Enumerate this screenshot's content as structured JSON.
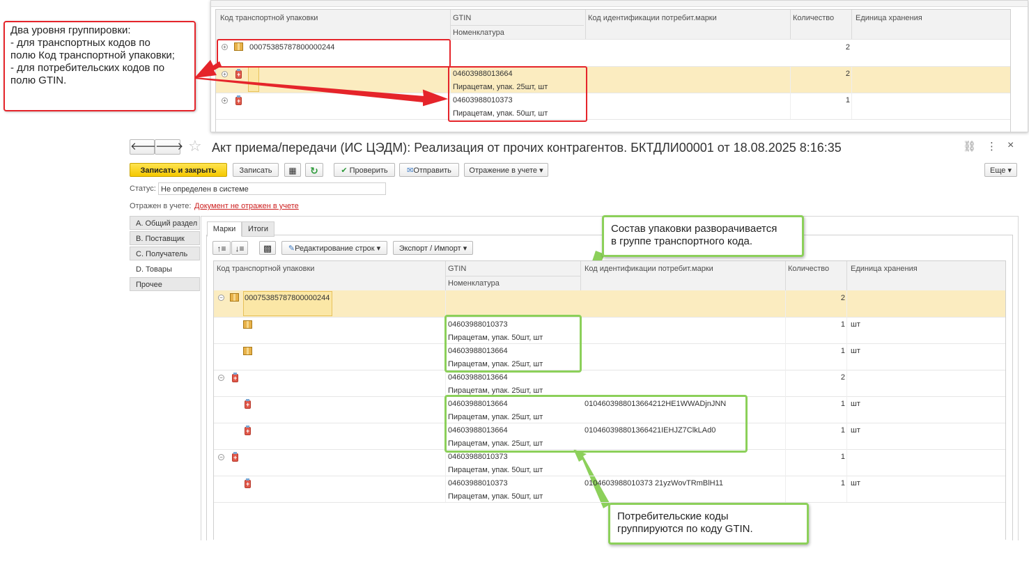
{
  "inset": {
    "columns": {
      "transport_code": "Код транспортной упаковки",
      "gtin": "GTIN",
      "nomenclature": "Номенклатура",
      "consumer_code": "Код идентификации потребит.марки",
      "quantity": "Количество",
      "unit": "Единица хранения"
    },
    "rows": [
      {
        "code": "00075385787800000244",
        "gtin": "",
        "name": "",
        "qty": "2"
      },
      {
        "code": "",
        "gtin": "04603988013664",
        "name": "Пирацетам, упак. 25шт, шт",
        "qty": "2"
      },
      {
        "code": "",
        "gtin": "04603988010373",
        "name": "Пирацетам, упак. 50шт, шт",
        "qty": "1"
      }
    ]
  },
  "annotations": {
    "red_note": "Два уровня группировки:\n- для транспортных кодов по\nполю Код транспортной упаковки;\n- для потребительских кодов по\nполю GTIN.",
    "green_top": "Состав упаковки разворачивается\nв группе транспортного кода.",
    "green_bottom": "Потребительские коды\nгруппируются по коду GTIN.",
    "red_color": "#e5242a",
    "green_color": "#8cd05a"
  },
  "window": {
    "title": "Акт приема/передачи (ИС ЦЭДМ): Реализация от прочих контрагентов.  БКТДЛИ00001 от 18.08.2025 8:16:35",
    "more_menu_icon": "⋮",
    "close_icon": "×"
  },
  "toolbar": {
    "save_close": "Записать и закрыть",
    "save": "Записать",
    "check": "Проверить",
    "send": "Отправить",
    "accounting": "Отражение в учете",
    "more": "Еще"
  },
  "status": {
    "label": "Статус:",
    "value": "Не определен в системе",
    "accounting_label": "Отражен в учете:",
    "accounting_link": "Документ не отражен в учете"
  },
  "sidebar": {
    "items": [
      {
        "label": "А. Общий раздел"
      },
      {
        "label": "B. Поставщик"
      },
      {
        "label": "C. Получатель"
      },
      {
        "label": "D. Товары"
      },
      {
        "label": "Прочее"
      }
    ]
  },
  "tabs": [
    {
      "label": "Марки"
    },
    {
      "label": "Итоги"
    }
  ],
  "grid_toolbar": {
    "edit_rows": "Редактирование строк",
    "export_import": "Экспорт / Импорт"
  },
  "grid": {
    "columns": {
      "transport_code": "Код транспортной упаковки",
      "gtin": "GTIN",
      "nomenclature": "Номенклатура",
      "consumer_code": "Код идентификации потребит.марки",
      "quantity": "Количество",
      "unit": "Единица хранения"
    },
    "rows": [
      {
        "code": "00075385787800000244",
        "gtin": "",
        "name": "",
        "consumer": "",
        "qty": "2",
        "unit": ""
      },
      {
        "code": "",
        "gtin": "04603988010373",
        "name": "Пирацетам, упак. 50шт, шт",
        "consumer": "",
        "qty": "1",
        "unit": "шт"
      },
      {
        "code": "",
        "gtin": "04603988013664",
        "name": "Пирацетам, упак. 25шт, шт",
        "consumer": "",
        "qty": "1",
        "unit": "шт"
      },
      {
        "code": "",
        "gtin": "04603988013664",
        "name": "Пирацетам, упак. 25шт, шт",
        "consumer": "",
        "qty": "2",
        "unit": ""
      },
      {
        "code": "",
        "gtin": "04603988013664",
        "name": "Пирацетам, упак. 25шт, шт",
        "consumer": "0104603988013664212HE1WWADjnJNN",
        "qty": "1",
        "unit": "шт"
      },
      {
        "code": "",
        "gtin": "04603988013664",
        "name": "Пирацетам, упак. 25шт, шт",
        "consumer": "010460398801366421IEHJZ7ClkLAd0",
        "qty": "1",
        "unit": "шт"
      },
      {
        "code": "",
        "gtin": "04603988010373",
        "name": "Пирацетам, упак. 50шт, шт",
        "consumer": "",
        "qty": "1",
        "unit": ""
      },
      {
        "code": "",
        "gtin": "04603988010373",
        "name": "Пирацетам, упак. 50шт, шт",
        "consumer": "0104603988010373 21yzWovTRmBlH11",
        "qty": "1",
        "unit": "шт"
      }
    ]
  }
}
